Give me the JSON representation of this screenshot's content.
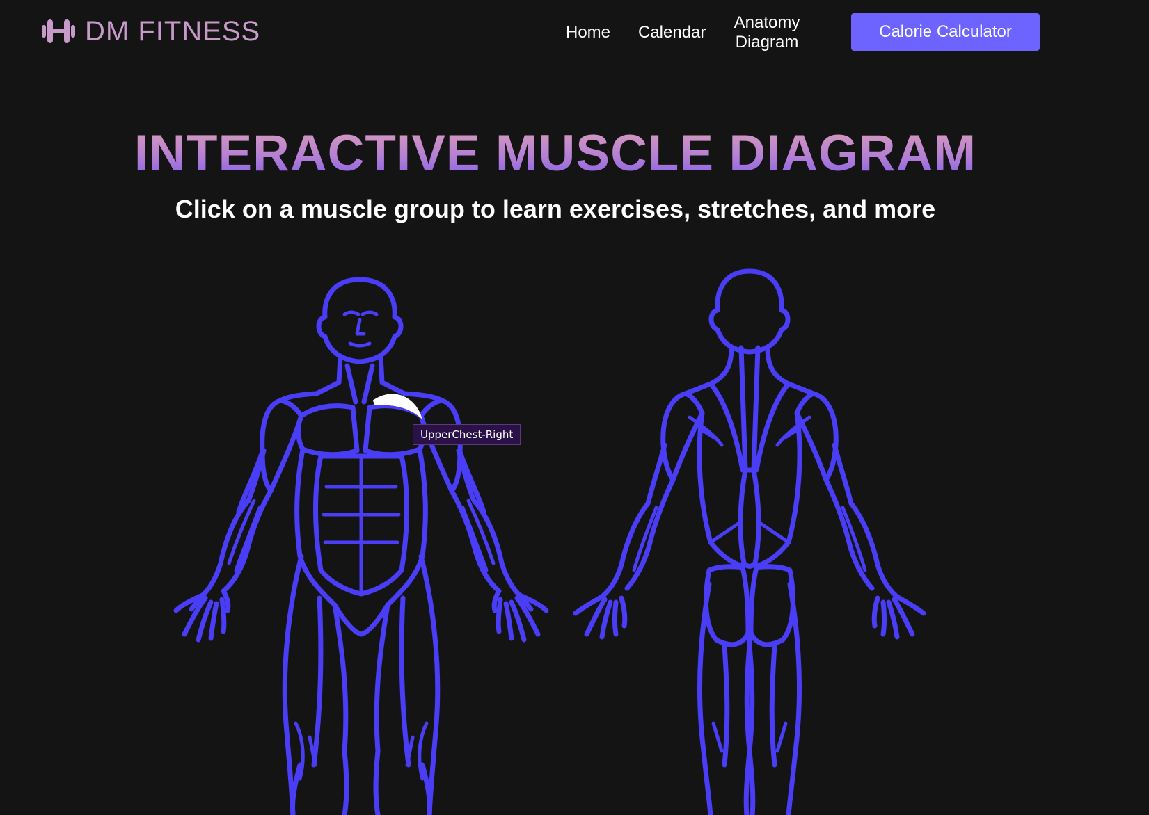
{
  "brand": {
    "name": "DM FITNESS",
    "icon": "dumbbell-icon"
  },
  "nav": {
    "home": "Home",
    "calendar": "Calendar",
    "anatomy_line1": "Anatomy",
    "anatomy_line2": "Diagram",
    "cta": "Calorie Calculator"
  },
  "hero": {
    "title": "INTERACTIVE MUSCLE DIAGRAM",
    "subtitle": "Click on a muscle group to learn exercises, stretches, and more"
  },
  "diagram": {
    "views": [
      "front",
      "back"
    ],
    "highlighted_muscle": "UpperChest-Right",
    "tooltip": "UpperChest-Right"
  },
  "colors": {
    "background": "#141414",
    "muscle_outline": "#4a3df6",
    "highlight": "#ffffff",
    "accent": "#6d63ff",
    "brand": "#c79ac9",
    "tooltip_bg": "#2a1148"
  }
}
